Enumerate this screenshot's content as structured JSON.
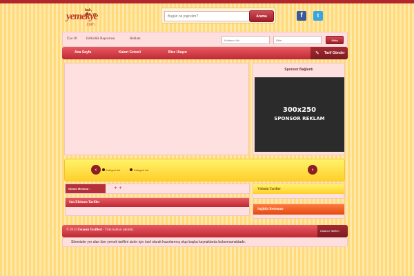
{
  "logo": {
    "word": "yemekye",
    "tagline": "bak, yap, ye",
    "domain": ".com"
  },
  "search": {
    "placeholder": "Bugün ne pişirelim?",
    "button": "Arama"
  },
  "social": {
    "facebook": "f",
    "twitter": "t"
  },
  "menu": {
    "links": [
      "Üye Ol",
      "Editörlük Başvurusu",
      "Reklam"
    ],
    "username_placeholder": "Kullanıcı Adı",
    "password_placeholder": "Şifre",
    "login_button": "Giriş"
  },
  "nav": {
    "items": [
      "Ana Sayfa",
      "Kalori Cetveli",
      "Bize Ulaşın"
    ],
    "submit_recipe": "Tarif Gönder"
  },
  "sponsor": {
    "title": "Sponsor Bağlantı",
    "ad_size": "300x250",
    "ad_label": "SPONSOR REKLAM"
  },
  "slider": {
    "labels": [
      "Kategori üst",
      "Kategori üst"
    ],
    "prev": "‹",
    "next": "›"
  },
  "today_menu": {
    "label": "Günün Menüsü :",
    "plus": "+ +"
  },
  "sections": {
    "newest": "Son Eklenen Tarifler",
    "video": "Videolu Tarifler",
    "health": "Sağlıklı Beslenme"
  },
  "footer": {
    "year": "© 2013",
    "brand": "Ustanın Tarifleri",
    "rights": "- Tüm hakları saklıdır.",
    "right_link": "Ustanın Tarifleri"
  },
  "disclaimer": "Sitemizde yer alan tüm yemek tarifleri sizler için özel olarak hazırlanmış olup başka kaynaklarda bulunmamaktadır.",
  "colors": {
    "primary_red": "#bf2934",
    "accent_yellow": "#ffcf2b",
    "panel_pink": "#ffe0e0",
    "facebook": "#3b5998",
    "twitter": "#38a7e0"
  }
}
